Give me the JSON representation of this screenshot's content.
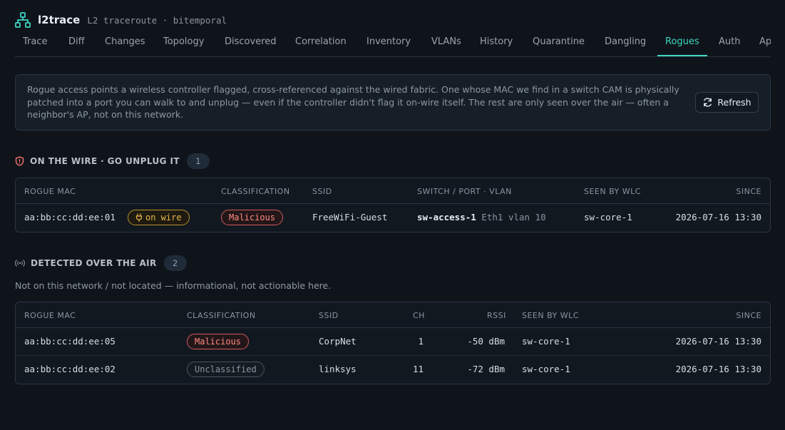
{
  "app": {
    "title": "l2trace",
    "subtitle": "L2 traceroute · bitemporal"
  },
  "tabs": [
    {
      "label": "Trace"
    },
    {
      "label": "Diff"
    },
    {
      "label": "Changes"
    },
    {
      "label": "Topology"
    },
    {
      "label": "Discovered"
    },
    {
      "label": "Correlation"
    },
    {
      "label": "Inventory"
    },
    {
      "label": "VLANs"
    },
    {
      "label": "History"
    },
    {
      "label": "Quarantine"
    },
    {
      "label": "Dangling"
    },
    {
      "label": "Rogues",
      "active": true
    },
    {
      "label": "Auth"
    },
    {
      "label": "Ap"
    }
  ],
  "info": {
    "text": "Rogue access points a wireless controller flagged, cross-referenced against the wired fabric. One whose MAC we find in a switch CAM is physically patched into a port you can walk to and unplug — even if the controller didn't flag it on-wire itself. The rest are only seen over the air — often a neighbor's AP, not on this network.",
    "refresh_label": "Refresh"
  },
  "on_wire": {
    "title": "ON THE WIRE · GO UNPLUG IT",
    "count": "1",
    "columns": [
      "ROGUE MAC",
      "CLASSIFICATION",
      "SSID",
      "SWITCH / PORT · VLAN",
      "SEEN BY WLC",
      "SINCE"
    ],
    "rows": [
      {
        "mac": "aa:bb:cc:dd:ee:01",
        "wire_badge": "on wire",
        "classification": "Malicious",
        "ssid": "FreeWiFi-Guest",
        "switch": "sw-access-1",
        "port": "Eth1",
        "vlan": "vlan 10",
        "wlc": "sw-core-1",
        "since": "2026-07-16 13:30"
      }
    ]
  },
  "over_air": {
    "title": "DETECTED OVER THE AIR",
    "count": "2",
    "note": "Not on this network / not located — informational, not actionable here.",
    "columns": [
      "ROGUE MAC",
      "CLASSIFICATION",
      "SSID",
      "CH",
      "RSSI",
      "SEEN BY WLC",
      "SINCE"
    ],
    "rows": [
      {
        "mac": "aa:bb:cc:dd:ee:05",
        "classification": "Malicious",
        "ssid": "CorpNet",
        "ch": "1",
        "rssi": "-50 dBm",
        "wlc": "sw-core-1",
        "since": "2026-07-16 13:30"
      },
      {
        "mac": "aa:bb:cc:dd:ee:02",
        "classification": "Unclassified",
        "ssid": "linksys",
        "ch": "11",
        "rssi": "-72 dBm",
        "wlc": "sw-core-1",
        "since": "2026-07-16 13:30"
      }
    ]
  },
  "colors": {
    "accent": "#3ed6c2",
    "malicious": "#ff8a80",
    "on_wire": "#e6b84a",
    "background": "#0f141a"
  }
}
